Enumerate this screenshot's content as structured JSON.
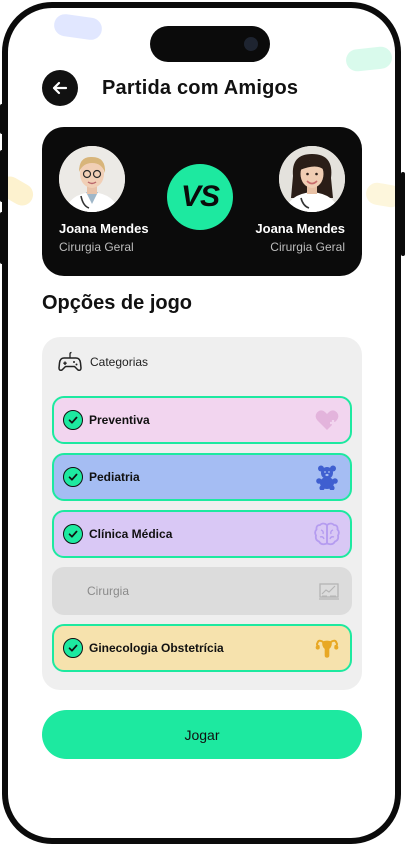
{
  "header": {
    "title": "Partida com Amigos",
    "back_icon": "arrow-left-icon"
  },
  "match": {
    "vs_label": "VS",
    "player1": {
      "name": "Joana Mendes",
      "specialty": "Cirurgia Geral"
    },
    "player2": {
      "name": "Joana Mendes",
      "specialty": "Cirurgia Geral"
    }
  },
  "options": {
    "section_title": "Opções de jogo",
    "categories_label": "Categorias",
    "categories_icon": "gamepad-icon",
    "items": [
      {
        "label": "Preventiva",
        "selected": true,
        "bg": "#f2d5ef",
        "icon": "heart-plus-icon",
        "icon_color": "#e3b4dc"
      },
      {
        "label": "Pediatria",
        "selected": true,
        "bg": "#a5bdf3",
        "icon": "teddy-bear-icon",
        "icon_color": "#3f5fd0"
      },
      {
        "label": "Clínica Médica",
        "selected": true,
        "bg": "#d9c8f5",
        "icon": "brain-icon",
        "icon_color": "#b59cf0"
      },
      {
        "label": "Cirurgia",
        "selected": false,
        "bg": "#dcdcdc",
        "icon": "chart-board-icon",
        "icon_color": "#b5b5b5"
      },
      {
        "label": "Ginecologia Obstetrícia",
        "selected": true,
        "bg": "#f6e2ad",
        "icon": "uterus-icon",
        "icon_color": "#e8a824"
      }
    ]
  },
  "play_button": {
    "label": "Jogar"
  },
  "colors": {
    "accent": "#1de9a0",
    "dark": "#0b0b0b"
  }
}
